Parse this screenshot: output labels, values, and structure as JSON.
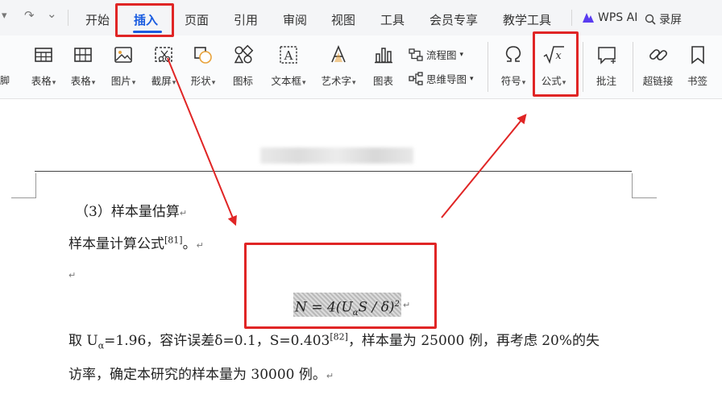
{
  "quick_access": {
    "undo_caret": "▾",
    "redo_glyph": "↷",
    "more_caret": "⌄"
  },
  "menu": {
    "items": [
      {
        "label": "开始"
      },
      {
        "label": "插入"
      },
      {
        "label": "页面"
      },
      {
        "label": "引用"
      },
      {
        "label": "审阅"
      },
      {
        "label": "视图"
      },
      {
        "label": "工具"
      },
      {
        "label": "会员专享"
      },
      {
        "label": "教学工具"
      }
    ],
    "active": "插入",
    "wps_ai": "WPS AI",
    "record": "录屏"
  },
  "ribbon": {
    "cut_left": "脚",
    "tools": [
      {
        "label": "表格",
        "caret": "▾",
        "icon": "table-icon"
      },
      {
        "label": "表格",
        "caret": "▾",
        "icon": "table-grid-icon"
      },
      {
        "label": "图片",
        "caret": "▾",
        "icon": "picture-icon"
      },
      {
        "label": "截屏",
        "caret": "▾",
        "icon": "screenshot-icon"
      },
      {
        "label": "形状",
        "caret": "▾",
        "icon": "shape-icon"
      },
      {
        "label": "图标",
        "caret": "",
        "icon": "icons-icon"
      },
      {
        "label": "文本框",
        "caret": "▾",
        "icon": "textbox-icon"
      },
      {
        "label": "艺术字",
        "caret": "▾",
        "icon": "wordart-icon"
      },
      {
        "label": "图表",
        "caret": "",
        "icon": "chart-icon"
      },
      {
        "label": "符号",
        "caret": "▾",
        "icon": "omega-icon"
      },
      {
        "label": "公式",
        "caret": "▾",
        "icon": "sqrt-x-icon"
      },
      {
        "label": "批注",
        "caret": "",
        "icon": "comment-icon"
      },
      {
        "label": "超链接",
        "caret": "",
        "icon": "link-icon"
      },
      {
        "label": "书签",
        "caret": "",
        "icon": "bookmark-icon"
      }
    ],
    "flowchart": {
      "label": "流程图",
      "caret": "▾"
    },
    "mindmap": {
      "label": "思维导图",
      "caret": "▾"
    }
  },
  "document": {
    "heading": "（3）样本量估算",
    "line1": "样本量计算公式",
    "line1_ref": "[81]",
    "line1_end": "。",
    "formula": "N = 4(U_α S / δ)²",
    "formula_parts": {
      "n": "N = 4(U",
      "sub": "α",
      "mid": "S / δ)",
      "sup": "2"
    },
    "para_p1": "取 U",
    "para_sub": "α",
    "para_p2": "=1.96，容许误差δ=0.1，S=0.403",
    "para_ref": "[82]",
    "para_p3": "，样本量为 25000 例，再考虑 20%的失",
    "para_line2": "访率，确定本研究的样本量为 30000 例。",
    "para_mark": "↵",
    "empty_mark": "↵"
  },
  "colors": {
    "accent": "#1a5ce0",
    "annotation_red": "#e02525",
    "ai_purple": "#5a3cf0"
  }
}
